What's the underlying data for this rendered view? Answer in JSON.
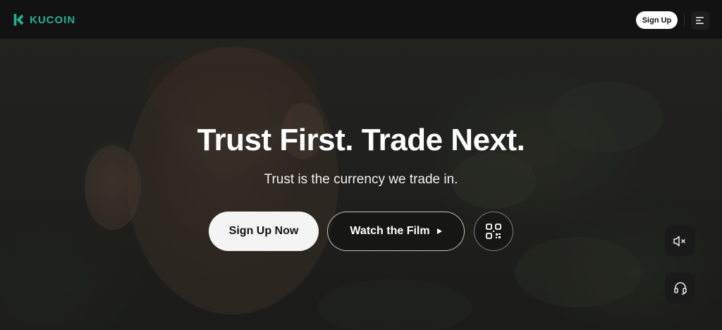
{
  "header": {
    "logo_text": "KUCOIN",
    "signup_label": "Sign Up",
    "menu_icon": "menu-icon"
  },
  "hero": {
    "title": "Trust First. Trade Next.",
    "subtitle": "Trust is the currency we trade in.",
    "primary_button": "Sign Up Now",
    "film_button": "Watch the Film",
    "film_icon": "play-icon",
    "qr_icon": "qr-code-icon"
  },
  "floating": {
    "mute_icon": "volume-mute-icon",
    "support_icon": "headset-icon"
  },
  "colors": {
    "brand": "#23af91",
    "header_bg": "#121212",
    "button_light": "#f4f4f4"
  }
}
